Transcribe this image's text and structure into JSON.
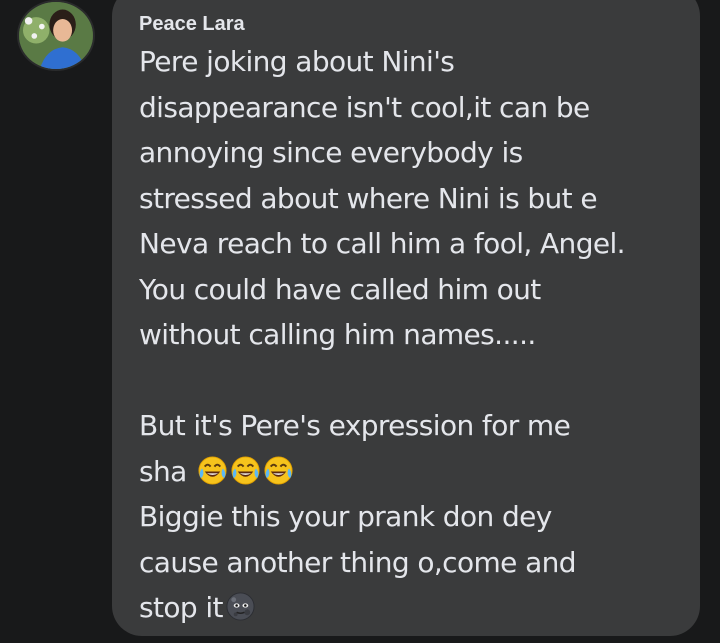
{
  "comment": {
    "author": "Peace Lara",
    "lines": [
      "Pere joking about Nini's",
      "disappearance isn't cool,it can be",
      "annoying since everybody is",
      "stressed about where Nini is but e",
      "Neva reach to call him a fool, Angel.",
      "You could have called him out",
      "without calling him names.....",
      "",
      "But it's Pere's expression for me",
      "sha",
      "Biggie this your prank don dey",
      "cause another thing o,come and",
      "stop it"
    ],
    "emojis": {
      "sha_line": [
        "tears-of-joy-emoji",
        "tears-of-joy-emoji",
        "tears-of-joy-emoji"
      ],
      "stop_line": [
        "new-moon-face-emoji"
      ]
    }
  },
  "colors": {
    "background": "#18191a",
    "bubble": "#3a3b3c",
    "text": "#e4e6eb"
  }
}
